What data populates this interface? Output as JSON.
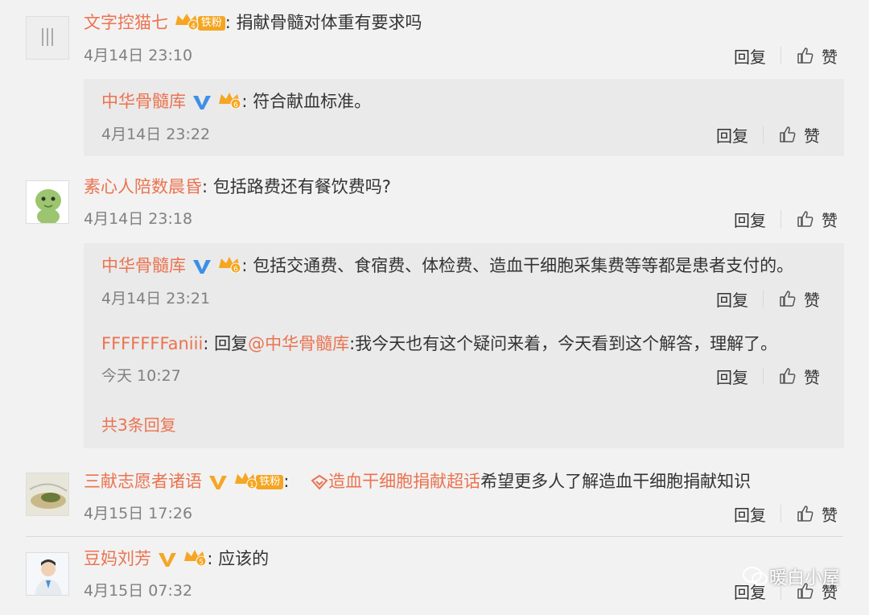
{
  "comments": [
    {
      "user": "文字控猫七",
      "badge_level": "4",
      "fan_label": "铁粉",
      "text": "捐献骨髓对体重有要求吗",
      "time": "4月14日 23:10",
      "reply_label": "回复",
      "like_label": "赞",
      "replies": [
        {
          "user": "中华骨髓库",
          "badge_level": "6",
          "text": "符合献血标准。",
          "time": "4月14日 23:22",
          "reply_label": "回复",
          "like_label": "赞"
        }
      ]
    },
    {
      "user": "素心人陪数晨昏",
      "text": "包括路费还有餐饮费吗?",
      "time": "4月14日 23:18",
      "reply_label": "回复",
      "like_label": "赞",
      "replies": [
        {
          "user": "中华骨髓库",
          "badge_level": "6",
          "text": "包括交通费、食宿费、体检费、造血干细胞采集费等等都是患者支付的。",
          "time": "4月14日 23:21",
          "reply_label": "回复",
          "like_label": "赞"
        },
        {
          "user": "FFFFFFFaniii",
          "text_prefix": "回复",
          "mention": "@中华骨髓库",
          "text": ":我今天也有这个疑问来着，今天看到这个解答，理解了。",
          "time": "今天 10:27",
          "reply_label": "回复",
          "like_label": "赞"
        }
      ],
      "more_replies": "共3条回复"
    },
    {
      "user": "三献志愿者诸语",
      "badge_level": "1",
      "fan_label": "铁粉",
      "topic": "造血干细胞捐献超话",
      "text": "希望更多人了解造血干细胞捐献知识",
      "time": "4月15日 17:26",
      "reply_label": "回复",
      "like_label": "赞"
    },
    {
      "user": "豆妈刘芳",
      "badge_level": "5",
      "text": "应该的",
      "time": "4月15日 07:32",
      "reply_label": "回复",
      "like_label": "赞"
    }
  ],
  "watermark": "暖白小屋",
  "colors": {
    "name": "#eb7350",
    "vip": "#f5a623",
    "fan": "#f4a623"
  }
}
